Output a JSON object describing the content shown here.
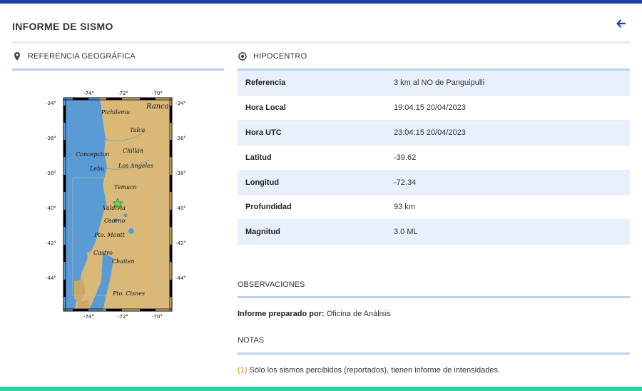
{
  "page": {
    "title": "INFORME DE SISMO",
    "back_icon": "arrow-left-icon",
    "accent": "#1e3fa8",
    "footer_color": "#2ed3a0"
  },
  "geo": {
    "title": "REFERENCIA GEOGRÁFICA",
    "icon": "map-pin-icon",
    "map": {
      "top_ticks": [
        "-74°",
        "-72°",
        "-70°"
      ],
      "bottom_ticks": [
        "-74°",
        "-72°",
        "-70°"
      ],
      "left_ticks": [
        "-34°",
        "-36°",
        "-38°",
        "-40°",
        "-42°",
        "-44°"
      ],
      "right_ticks": [
        "-34°",
        "-36°",
        "-38°",
        "-40°",
        "-42°",
        "-44°"
      ],
      "places": [
        "Pichilemu",
        "Ranca",
        "Talca",
        "Concepcion",
        "Chillán",
        "Lebu",
        "Los Angeles",
        "Temuco",
        "Valdivia",
        "Osorno",
        "Pto. Montt",
        "Castro",
        "Chaiten",
        "Pto. Cisnes"
      ]
    }
  },
  "hypo": {
    "title": "HIPOCENTRO",
    "icon": "target-icon",
    "rows": [
      {
        "label": "Referencia",
        "value": "3 km al NO de Panguipulli"
      },
      {
        "label": "Hora Local",
        "value": "19:04:15 20/04/2023"
      },
      {
        "label": "Hora UTC",
        "value": "23:04:15 20/04/2023"
      },
      {
        "label": "Latitud",
        "value": "-39.62"
      },
      {
        "label": "Longitud",
        "value": "-72.34"
      },
      {
        "label": "Profundidad",
        "value": "93 km"
      },
      {
        "label": "Magnitud",
        "value": "3.0 ML"
      }
    ]
  },
  "obs": {
    "title": "OBSERVACIONES",
    "prepared_label": "Informe preparado por:",
    "prepared_value": "Oficina de Análisis"
  },
  "notes": {
    "title": "NOTAS",
    "items": [
      {
        "num": "(1)",
        "text": "Sólo los sismos percibidos (reportados), tienen informe de intensidades."
      }
    ]
  }
}
